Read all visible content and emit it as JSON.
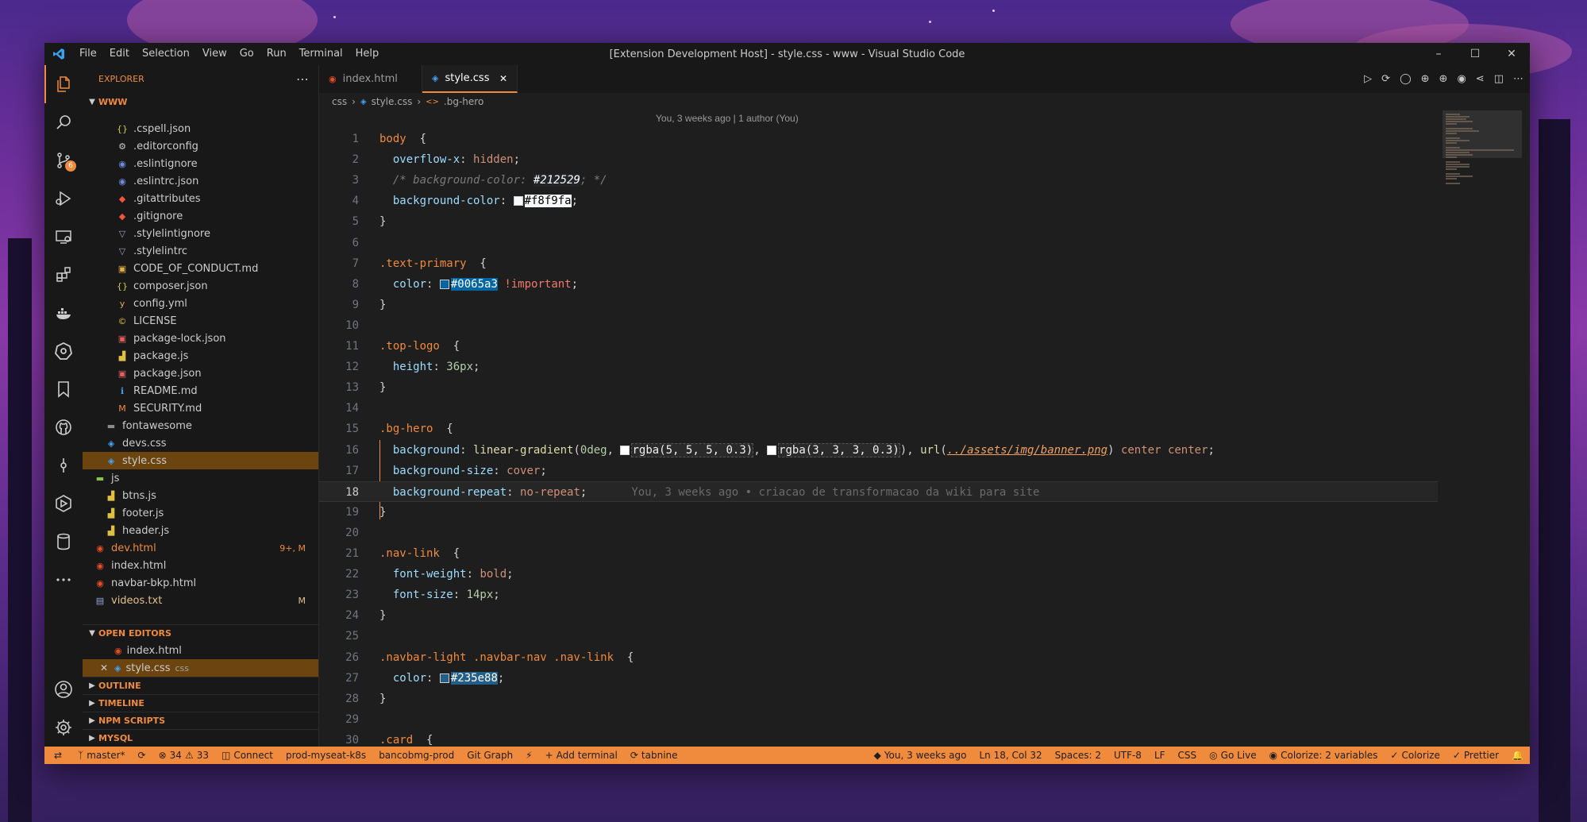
{
  "window": {
    "title": "[Extension Development Host] - style.css - www - Visual Studio Code",
    "menu": [
      "File",
      "Edit",
      "Selection",
      "View",
      "Go",
      "Run",
      "Terminal",
      "Help"
    ]
  },
  "activity_bar": {
    "top": [
      "explorer-icon",
      "search-icon",
      "source-control-icon",
      "run-debug-icon",
      "remote-explorer-icon",
      "extensions-icon",
      "docker-icon",
      "kubernetes-icon",
      "bookmarks-icon",
      "github-icon",
      "git-graph-icon",
      "deploy-icon",
      "database-icon",
      "more-icon"
    ],
    "source_control_badge": "6",
    "bottom": [
      "account-icon",
      "settings-gear-icon"
    ]
  },
  "explorer": {
    "title": "EXPLORER",
    "folder": "WWW",
    "items": [
      {
        "name": ".cspell.json",
        "icon": "{}",
        "iconColor": "#cbcb41",
        "indent": 2,
        "cls": ""
      },
      {
        "name": ".editorconfig",
        "icon": "⚙",
        "iconColor": "#cccccc",
        "indent": 2,
        "cls": ""
      },
      {
        "name": ".eslintignore",
        "icon": "◉",
        "iconColor": "#6d8bdf",
        "indent": 2,
        "cls": ""
      },
      {
        "name": ".eslintrc.json",
        "icon": "◉",
        "iconColor": "#6d8bdf",
        "indent": 2,
        "cls": ""
      },
      {
        "name": ".gitattributes",
        "icon": "◆",
        "iconColor": "#f0553c",
        "indent": 2,
        "cls": ""
      },
      {
        "name": ".gitignore",
        "icon": "◆",
        "iconColor": "#f0553c",
        "indent": 2,
        "cls": ""
      },
      {
        "name": ".stylelintignore",
        "icon": "▽",
        "iconColor": "#a0a0c0",
        "indent": 2,
        "cls": ""
      },
      {
        "name": ".stylelintrc",
        "icon": "▽",
        "iconColor": "#a0a0c0",
        "indent": 2,
        "cls": ""
      },
      {
        "name": "CODE_OF_CONDUCT.md",
        "icon": "▣",
        "iconColor": "#e0b040",
        "indent": 2,
        "cls": ""
      },
      {
        "name": "composer.json",
        "icon": "{}",
        "iconColor": "#cbcb41",
        "indent": 2,
        "cls": ""
      },
      {
        "name": "config.yml",
        "icon": "y",
        "iconColor": "#e0b040",
        "indent": 2,
        "cls": ""
      },
      {
        "name": "LICENSE",
        "icon": "©",
        "iconColor": "#e0c040",
        "indent": 2,
        "cls": ""
      },
      {
        "name": "package-lock.json",
        "icon": "▣",
        "iconColor": "#e06060",
        "indent": 2,
        "cls": ""
      },
      {
        "name": "package.js",
        "icon": "▟",
        "iconColor": "#e0c040",
        "indent": 2,
        "cls": ""
      },
      {
        "name": "package.json",
        "icon": "▣",
        "iconColor": "#e06060",
        "indent": 2,
        "cls": ""
      },
      {
        "name": "README.md",
        "icon": "ℹ",
        "iconColor": "#4aa0f0",
        "indent": 2,
        "cls": ""
      },
      {
        "name": "SECURITY.md",
        "icon": "M",
        "iconColor": "#f08a3c",
        "indent": 2,
        "cls": ""
      },
      {
        "name": "fontawesome",
        "icon": "▬",
        "iconColor": "#8a8a8a",
        "indent": 1,
        "cls": ""
      },
      {
        "name": "devs.css",
        "icon": "◈",
        "iconColor": "#42a5f5",
        "indent": 1,
        "cls": ""
      },
      {
        "name": "style.css",
        "icon": "◈",
        "iconColor": "#42a5f5",
        "indent": 1,
        "cls": "selected"
      },
      {
        "name": "js",
        "icon": "▬",
        "iconColor": "#8bc34a",
        "indent": 0,
        "cls": ""
      },
      {
        "name": "btns.js",
        "icon": "▟",
        "iconColor": "#e0c040",
        "indent": 1,
        "cls": ""
      },
      {
        "name": "footer.js",
        "icon": "▟",
        "iconColor": "#e0c040",
        "indent": 1,
        "cls": ""
      },
      {
        "name": "header.js",
        "icon": "▟",
        "iconColor": "#e0c040",
        "indent": 1,
        "cls": ""
      },
      {
        "name": "dev.html",
        "icon": "◉",
        "iconColor": "#e44d26",
        "indent": 0,
        "cls": "modified-o",
        "deco": "9+, M"
      },
      {
        "name": "index.html",
        "icon": "◉",
        "iconColor": "#e44d26",
        "indent": 0,
        "cls": ""
      },
      {
        "name": "navbar-bkp.html",
        "icon": "◉",
        "iconColor": "#e44d26",
        "indent": 0,
        "cls": ""
      },
      {
        "name": "videos.txt",
        "icon": "▤",
        "iconColor": "#9aa4d8",
        "indent": 0,
        "cls": "modified",
        "deco": "M"
      }
    ]
  },
  "open_editors": {
    "title": "OPEN EDITORS",
    "items": [
      {
        "name": "index.html",
        "desc": "",
        "icon": "◉",
        "iconColor": "#e44d26",
        "active": false
      },
      {
        "name": "style.css",
        "desc": "css",
        "icon": "◈",
        "iconColor": "#42a5f5",
        "active": true
      }
    ]
  },
  "collapsed_sections": [
    "OUTLINE",
    "TIMELINE",
    "NPM SCRIPTS",
    "MYSQL"
  ],
  "tabs": [
    {
      "label": "index.html",
      "active": false,
      "icon": "◉",
      "iconColor": "#e44d26"
    },
    {
      "label": "style.css",
      "active": true,
      "icon": "◈",
      "iconColor": "#42a5f5"
    }
  ],
  "breadcrumbs": [
    "css",
    "style.css",
    ".bg-hero"
  ],
  "codelens": "You, 3 weeks ago | 1 author (You)",
  "current_line": 18,
  "blame": "You, 3 weeks ago • criacao de transformacao da wiki para site",
  "code_lines": [
    [
      [
        "sel",
        "body"
      ],
      [
        "",
        "  {"
      ]
    ],
    [
      [
        "",
        "  "
      ],
      [
        "prop",
        "overflow-x"
      ],
      [
        "",
        ": "
      ],
      [
        "val",
        "hidden"
      ],
      [
        "",
        ";"
      ]
    ],
    [
      [
        "",
        "  "
      ],
      [
        "com",
        "/* background-color: "
      ],
      [
        "hlc",
        "#212529"
      ],
      [
        "com",
        "; */"
      ]
    ],
    [
      [
        "",
        "  "
      ],
      [
        "prop",
        "background-color"
      ],
      [
        "",
        ": "
      ],
      [
        "sw",
        "#f8f9fa"
      ],
      [
        "hlw",
        "#f8f9fa"
      ],
      [
        "",
        ";"
      ]
    ],
    [
      [
        "",
        "}"
      ]
    ],
    [],
    [
      [
        "sel",
        ".text-primary"
      ],
      [
        "",
        ""
      ],
      [
        "",
        ""
      ],
      [
        "",
        ""
      ],
      [
        "",
        ""
      ],
      [
        "",
        "  {"
      ]
    ],
    [
      [
        "",
        "  "
      ],
      [
        "prop",
        "color"
      ],
      [
        "",
        ": "
      ],
      [
        "sw",
        "#0065a3"
      ],
      [
        "hlb",
        "#0065a3"
      ],
      [
        "",
        ""
      ],
      [
        "imp",
        " !important"
      ],
      [
        "",
        ";"
      ]
    ],
    [
      [
        "",
        "}"
      ]
    ],
    [],
    [
      [
        "sel",
        ".top-logo"
      ],
      [
        "",
        "  {"
      ]
    ],
    [
      [
        "",
        "  "
      ],
      [
        "prop",
        "height"
      ],
      [
        "",
        ": "
      ],
      [
        "num",
        "36px"
      ],
      [
        "",
        ";"
      ]
    ],
    [
      [
        "",
        "}"
      ]
    ],
    [],
    [
      [
        "sel",
        ".bg-hero"
      ],
      [
        "",
        "  {"
      ]
    ],
    [
      [
        "",
        "  "
      ],
      [
        "prop",
        "background"
      ],
      [
        "",
        ": "
      ],
      [
        "fn",
        "linear-gradient"
      ],
      [
        "",
        "("
      ],
      [
        "num",
        "0deg"
      ],
      [
        "",
        ", "
      ],
      [
        "sw",
        "#ffffff"
      ],
      [
        "hld",
        "rgba(5, 5, 5, 0.3)"
      ],
      [
        "",
        ", "
      ],
      [
        "sw",
        "#ffffff"
      ],
      [
        "hld",
        "rgba(3, 3, 3, 0.3)"
      ],
      [
        "",
        "), "
      ],
      [
        "fn",
        "url"
      ],
      [
        "",
        "("
      ],
      [
        "url",
        "../assets/img/banner.png"
      ],
      [
        "",
        ") "
      ],
      [
        "val",
        "center center"
      ],
      [
        "",
        ";"
      ]
    ],
    [
      [
        "",
        "  "
      ],
      [
        "prop",
        "background-size"
      ],
      [
        "",
        ": "
      ],
      [
        "val",
        "cover"
      ],
      [
        "",
        ";"
      ]
    ],
    [
      [
        "",
        "  "
      ],
      [
        "prop",
        "background-repeat"
      ],
      [
        "",
        ": "
      ],
      [
        "val",
        "no-repeat"
      ],
      [
        "",
        ";"
      ],
      [
        "blame",
        ""
      ]
    ],
    [
      [
        "",
        "}"
      ]
    ],
    [],
    [
      [
        "sel",
        ".nav-link"
      ],
      [
        "",
        "  {"
      ]
    ],
    [
      [
        "",
        "  "
      ],
      [
        "prop",
        "font-weight"
      ],
      [
        "",
        ": "
      ],
      [
        "val",
        "bold"
      ],
      [
        "",
        ";"
      ]
    ],
    [
      [
        "",
        "  "
      ],
      [
        "prop",
        "font-size"
      ],
      [
        "",
        ": "
      ],
      [
        "num",
        "14px"
      ],
      [
        "",
        ";"
      ]
    ],
    [
      [
        "",
        "}"
      ]
    ],
    [],
    [
      [
        "sel",
        ".navbar-light .navbar-nav .nav-link"
      ],
      [
        "",
        "  {"
      ]
    ],
    [
      [
        "",
        "  "
      ],
      [
        "prop",
        "color"
      ],
      [
        "",
        ": "
      ],
      [
        "sw",
        "#235e88"
      ],
      [
        "hlb2",
        "#235e88"
      ],
      [
        "",
        ";"
      ]
    ],
    [
      [
        "",
        "}"
      ]
    ],
    [],
    [
      [
        "sel",
        ".card"
      ],
      [
        "",
        "  {"
      ]
    ]
  ],
  "status": {
    "left": [
      "master*",
      "34",
      "33",
      "Connect",
      "prod-myseat-k8s",
      "bancobmg-prod",
      "Git Graph",
      "Add terminal",
      "tabnine"
    ],
    "right": [
      "You, 3 weeks ago",
      "Ln 18, Col 32",
      "Spaces: 2",
      "UTF-8",
      "LF",
      "CSS",
      "Go Live",
      "Colorize: 2 variables",
      "Colorize",
      "Prettier"
    ]
  }
}
